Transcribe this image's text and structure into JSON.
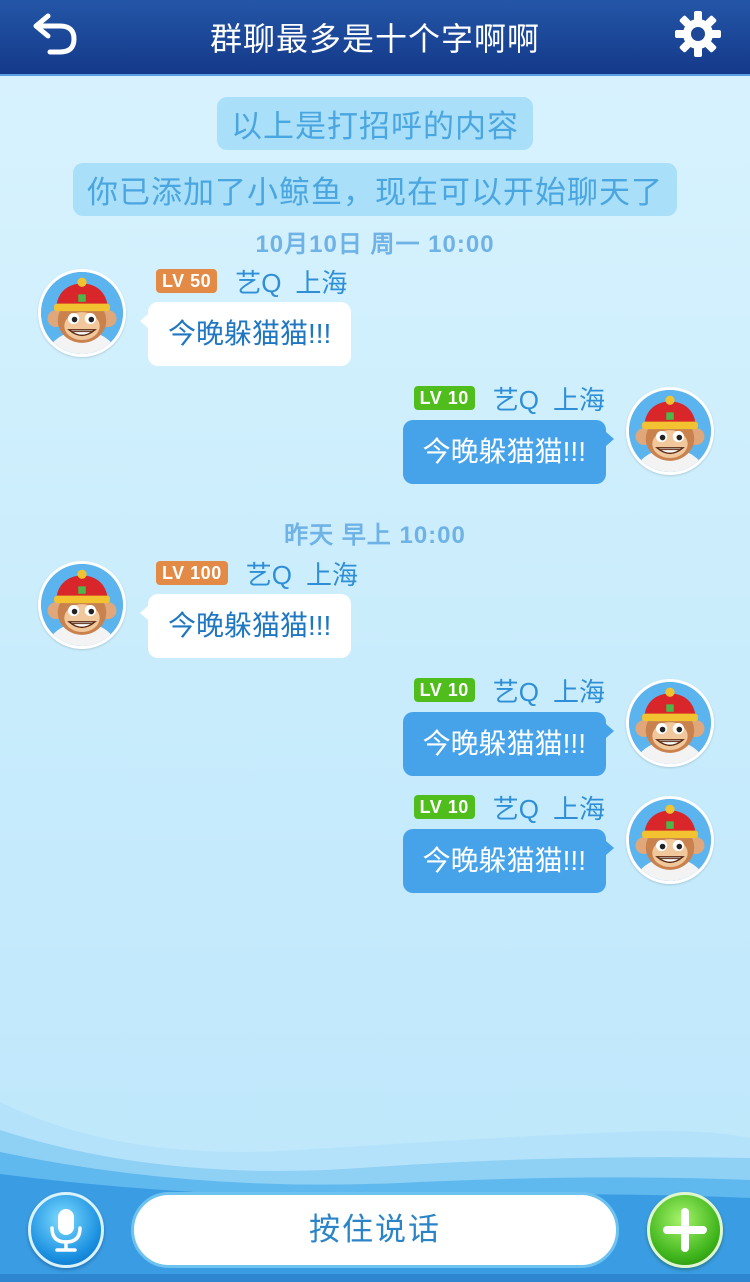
{
  "header": {
    "title": "群聊最多是十个字啊啊",
    "back_icon": "back-arrow-icon",
    "settings_icon": "gear-icon"
  },
  "notices": [
    "以上是打招呼的内容",
    "你已添加了小鲸鱼，现在可以开始聊天了"
  ],
  "timestamps": [
    "10月10日 周一 10:00",
    "昨天 早上 10:00"
  ],
  "messages": [
    {
      "side": "left",
      "level": "LV 50",
      "level_color": "#e28a46",
      "name": "艺Q",
      "city": "上海",
      "text": "今晚躲猫猫!!!"
    },
    {
      "side": "right",
      "level": "LV 10",
      "level_color": "#4fbd1c",
      "name": "艺Q",
      "city": "上海",
      "text": "今晚躲猫猫!!!"
    },
    {
      "side": "left",
      "level": "LV 100",
      "level_color": "#e28a46",
      "name": "艺Q",
      "city": "上海",
      "text": "今晚躲猫猫!!!"
    },
    {
      "side": "right",
      "level": "LV 10",
      "level_color": "#4fbd1c",
      "name": "艺Q",
      "city": "上海",
      "text": "今晚躲猫猫!!!"
    },
    {
      "side": "right",
      "level": "LV 10",
      "level_color": "#4fbd1c",
      "name": "艺Q",
      "city": "上海",
      "text": "今晚躲猫猫!!!"
    }
  ],
  "input_bar": {
    "mic_icon": "microphone-icon",
    "talk_label": "按住说话",
    "plus_icon": "plus-icon"
  },
  "colors": {
    "header_bg": "#1d4797",
    "bubble_self": "#46a3ea",
    "bubble_other": "#ffffff",
    "accent_text": "#2f8fd6"
  }
}
